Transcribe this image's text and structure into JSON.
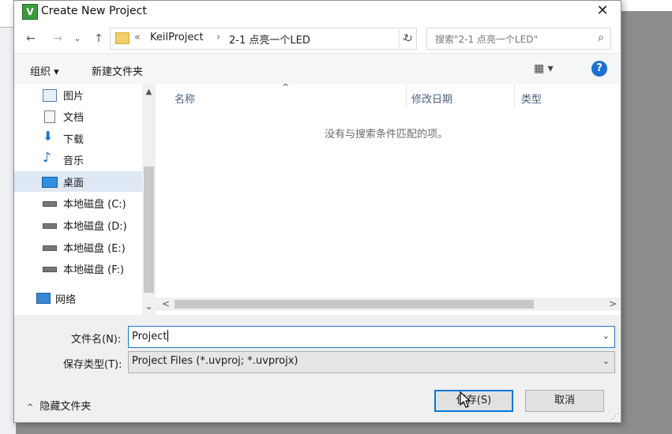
{
  "window": {
    "title": "Create New Project",
    "app_icon_letter": "V",
    "close_glyph": "✕"
  },
  "nav": {
    "back_glyph": "←",
    "forward_glyph": "→",
    "recent_glyph": "⌄",
    "up_glyph": "↑"
  },
  "address": {
    "overflow": "«",
    "segments": [
      "KeilProject",
      "›",
      "2-1 点亮一个LED"
    ],
    "dropdown_glyph": "⌄",
    "refresh_glyph": "↻"
  },
  "search": {
    "placeholder": "搜索\"2-1 点亮一个LED\"",
    "icon": "⌕"
  },
  "toolbar": {
    "organize": "组织 ▾",
    "new_folder": "新建文件夹",
    "view_glyph": "▦ ▾",
    "help_glyph": "?"
  },
  "sidebar": {
    "items": [
      {
        "label": "图片",
        "icon": "pictures-icon"
      },
      {
        "label": "文档",
        "icon": "documents-icon"
      },
      {
        "label": "下载",
        "icon": "download-icon"
      },
      {
        "label": "音乐",
        "icon": "music-icon"
      },
      {
        "label": "桌面",
        "icon": "desktop-icon"
      },
      {
        "label": "本地磁盘 (C:)",
        "icon": "drive-c-icon"
      },
      {
        "label": "本地磁盘 (D:)",
        "icon": "drive-icon"
      },
      {
        "label": "本地磁盘 (E:)",
        "icon": "drive-icon"
      },
      {
        "label": "本地磁盘 (F:)",
        "icon": "drive-icon"
      },
      {
        "label": "网络",
        "icon": "network-icon"
      }
    ],
    "selected_index": 4
  },
  "file_list": {
    "columns": [
      "名称",
      "修改日期",
      "类型"
    ],
    "sort_glyph": "^",
    "empty_message": "没有与搜索条件匹配的项。"
  },
  "scroll": {
    "up": "▲",
    "down": "⌄",
    "left": "<",
    "right": ">"
  },
  "form": {
    "filename_label": "文件名(N):",
    "filename_value": "Project",
    "filetype_label": "保存类型(T):",
    "filetype_value": "Project Files (*.uvproj; *.uvprojx)",
    "dropdown_glyph": "⌄"
  },
  "footer": {
    "hide_folders": "隐藏文件夹",
    "chevron": "^",
    "save": "保存(S)",
    "cancel": "取消",
    "grip": "⋰"
  },
  "colors": {
    "accent": "#0078d7",
    "selected_row": "#dfe9f5",
    "header_text": "#4c607a"
  }
}
